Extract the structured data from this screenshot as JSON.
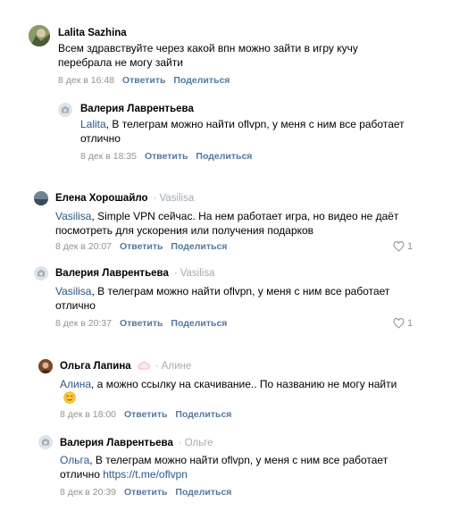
{
  "comments": [
    {
      "author": "Lalita Sazhina",
      "text": "Всем здравствуйте через какой впн можно зайти в игру кучу перебрала не могу зайти",
      "time": "8 дек в 16:48",
      "reply": "Ответить",
      "share": "Поделиться"
    },
    {
      "author": "Валерия Лаврентьева",
      "mention": "Lalita",
      "text": ", В телеграм можно найти oflvpn, у меня с ним все работает отлично",
      "time": "8 дек в 18:35",
      "reply": "Ответить",
      "share": "Поделиться"
    },
    {
      "author": "Елена Хорошайло",
      "reply_to": "Vasilisa",
      "mention": "Vasilisa",
      "text": ", Simple VPN сейчас. На нем работает игра, но видео не даёт посмотреть для ускорения или получения подарков",
      "time": "8 дек в 20:07",
      "reply": "Ответить",
      "share": "Поделиться",
      "likes": "1"
    },
    {
      "author": "Валерия Лаврентьева",
      "reply_to": "Vasilisa",
      "mention": "Vasilisa",
      "text": ", В телеграм можно найти oflvpn, у меня с ним все работает отлично",
      "time": "8 дек в 20:37",
      "reply": "Ответить",
      "share": "Поделиться",
      "likes": "1"
    },
    {
      "author": "Ольга Лапина",
      "reply_to": "Алине",
      "mention": "Алина",
      "text": ", а можно ссылку на скачивание.. По названию не могу найти",
      "time": "8 дек в 18:00",
      "reply": "Ответить",
      "share": "Поделиться"
    },
    {
      "author": "Валерия Лаврентьева",
      "reply_to": "Ольге",
      "mention": "Ольга",
      "text": ", В телеграм можно найти oflvpn, у меня с ним все работает отлично ",
      "link": "https://t.me/oflvpn",
      "time": "8 дек в 20:39",
      "reply": "Ответить",
      "share": "Поделиться"
    }
  ],
  "colors": {
    "link": "#2a5885",
    "muted": "#939393",
    "reply_to": "#a4acb5"
  },
  "icons": {
    "like": "heart-outline-icon",
    "default_avatar": "camera-placeholder-icon"
  }
}
